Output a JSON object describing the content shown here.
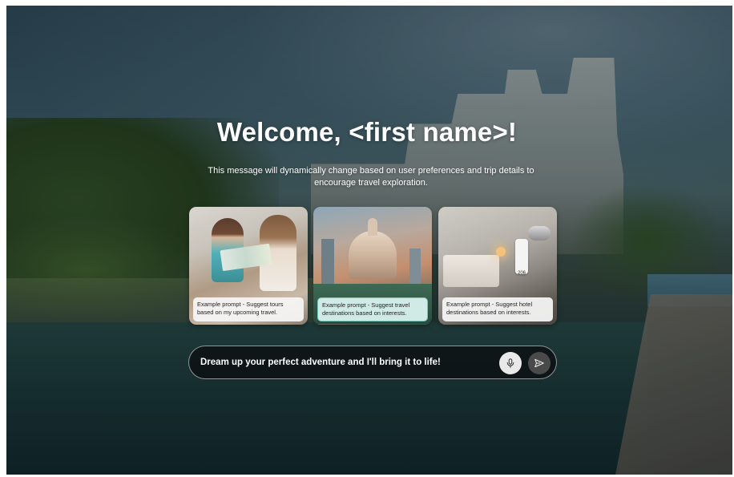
{
  "hero": {
    "welcome": "Welcome, <first name>!",
    "subtitle": "This message will dynamically change based on user preferences and trip details to encourage travel exploration."
  },
  "cards": [
    {
      "icon": "tours-photo",
      "label": "Example prompt - Suggest tours based on my upcoming travel."
    },
    {
      "icon": "destinations-photo",
      "label": "Example prompt - Suggest travel destinations based on interests."
    },
    {
      "icon": "hotel-photo",
      "label": "Example prompt - Suggest hotel destinations based on interests.",
      "key_tag": "206"
    }
  ],
  "prompt": {
    "placeholder": "Dream up your perfect adventure and I'll bring it to life!",
    "mic_icon": "microphone-icon",
    "send_icon": "send-icon"
  },
  "colors": {
    "text": "#ffffff",
    "prompt_bg": "#0c1012",
    "selected_card": "#d6f0ec",
    "selected_card_border": "#7cc7bd",
    "mic_button": "#e9e9e9",
    "send_button": "#4a4a4a"
  }
}
